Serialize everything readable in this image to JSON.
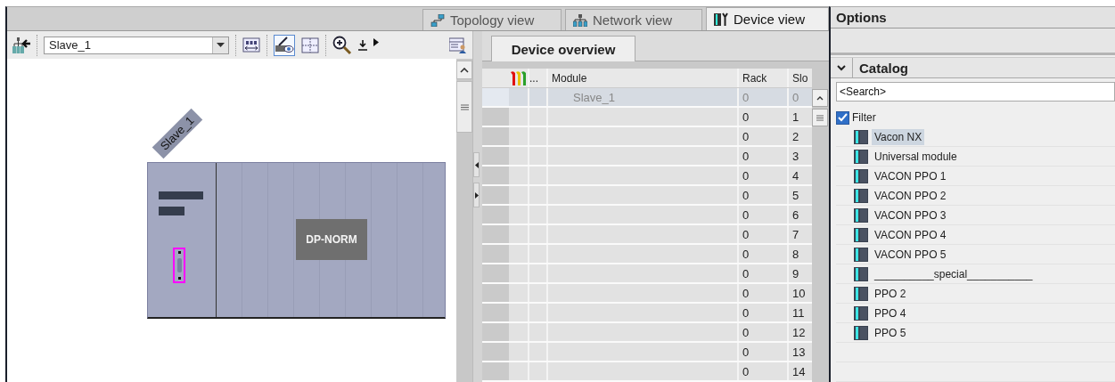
{
  "view_tabs": [
    {
      "label": "Topology view",
      "kind": "topology",
      "selected": false
    },
    {
      "label": "Network view",
      "kind": "network",
      "selected": false
    },
    {
      "label": "Device view",
      "kind": "device",
      "selected": true
    }
  ],
  "toolbar": {
    "device_select": {
      "value": "Slave_1"
    }
  },
  "device_drawing": {
    "label": "Slave_1",
    "module_label": "DP-NORM"
  },
  "device_overview": {
    "tab": "Device overview",
    "columns": [
      "...",
      "Module",
      "Rack",
      "Slo"
    ],
    "rows": [
      {
        "module": "Slave_1",
        "rack": "0",
        "slot": "0",
        "selected": true
      },
      {
        "rack": "0",
        "slot": "1",
        "selected": false
      },
      {
        "rack": "0",
        "slot": "2",
        "selected": false
      },
      {
        "rack": "0",
        "slot": "3",
        "selected": false
      },
      {
        "rack": "0",
        "slot": "4",
        "selected": false
      },
      {
        "rack": "0",
        "slot": "5",
        "selected": false
      },
      {
        "rack": "0",
        "slot": "6",
        "selected": false
      },
      {
        "rack": "0",
        "slot": "7",
        "selected": false
      },
      {
        "rack": "0",
        "slot": "8",
        "selected": false
      },
      {
        "rack": "0",
        "slot": "9",
        "selected": false
      },
      {
        "rack": "0",
        "slot": "10",
        "selected": false
      },
      {
        "rack": "0",
        "slot": "11",
        "selected": false
      },
      {
        "rack": "0",
        "slot": "12",
        "selected": false
      },
      {
        "rack": "0",
        "slot": "13",
        "selected": false
      },
      {
        "rack": "0",
        "slot": "14",
        "selected": false
      }
    ]
  },
  "options": {
    "title": "Options"
  },
  "catalog": {
    "title": "Catalog",
    "expanded": true,
    "search": {
      "placeholder": "<Search>"
    },
    "filter": {
      "label": "Filter",
      "checked": true
    },
    "items": [
      {
        "label": "Vacon NX",
        "selected": true
      },
      {
        "label": "Universal module",
        "selected": false
      },
      {
        "label": "VACON PPO 1",
        "selected": false
      },
      {
        "label": "VACON PPO 2",
        "selected": false
      },
      {
        "label": "VACON PPO 3",
        "selected": false
      },
      {
        "label": "VACON PPO 4",
        "selected": false
      },
      {
        "label": "VACON PPO 5",
        "selected": false
      },
      {
        "label": "__________special___________",
        "selected": false
      },
      {
        "label": "PPO 2",
        "selected": false
      },
      {
        "label": "PPO 4",
        "selected": false
      },
      {
        "label": "PPO 5",
        "selected": false
      }
    ]
  }
}
